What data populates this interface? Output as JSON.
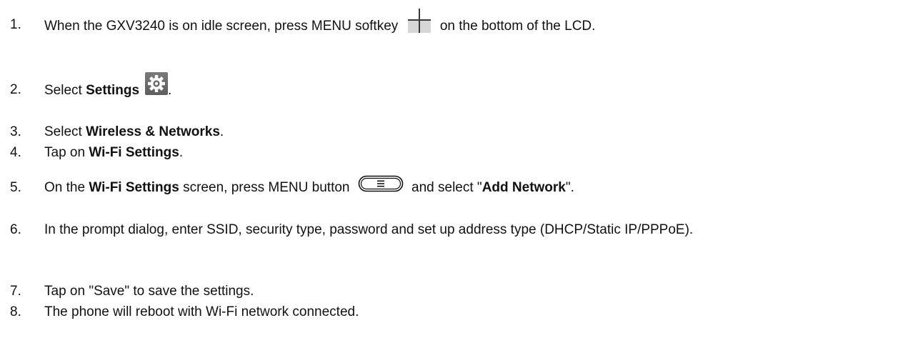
{
  "steps": [
    {
      "num": "1.",
      "pre": "When the GXV3240 is on idle screen, press MENU softkey ",
      "post": " on the bottom of the LCD."
    },
    {
      "num": "2.",
      "pre": "Select ",
      "bold": "Settings",
      "post": "."
    },
    {
      "num": "3.",
      "pre": "Select ",
      "bold": "Wireless & Networks",
      "post": "."
    },
    {
      "num": "4.",
      "pre": "Tap on ",
      "bold": "Wi-Fi Settings",
      "post": "."
    },
    {
      "num": "5.",
      "pre": "On the ",
      "bold": "Wi-Fi Settings",
      "mid": " screen, press MENU button ",
      "mid2": " and select \"",
      "bold2": "Add Network",
      "post": "\"."
    },
    {
      "num": "6.",
      "text": "In the prompt dialog, enter SSID, security type, password and set up address type (DHCP/Static IP/PPPoE)."
    },
    {
      "num": "7.",
      "text": "Tap on \"Save\" to save the settings."
    },
    {
      "num": "8.",
      "text": "The phone will reboot with Wi-Fi network connected."
    }
  ],
  "icons": {
    "step1": "menu-softkey-icon",
    "step2": "settings-gear-icon",
    "step5": "menu-button-icon"
  }
}
